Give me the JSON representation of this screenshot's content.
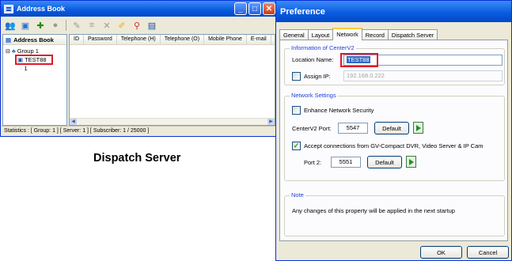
{
  "address_book": {
    "title": "Address Book",
    "toolbar_icons": [
      "users-icon",
      "computer-icon",
      "add-user-icon",
      "user-icon",
      "edit-icon",
      "list-icon",
      "delete-icon",
      "folder-icon",
      "connect-icon",
      "monitor-icon"
    ],
    "tree": {
      "header": "Address Book",
      "group": "Group 1",
      "selected_item": "TEST88",
      "sub_item": "1"
    },
    "columns": [
      "ID",
      "Password",
      "Telephone (H)",
      "Telephone (O)",
      "Mobile Phone",
      "E-mail"
    ],
    "status": "Statistics : [ Group: 1 ]  [ Server: 1 ]  [ Subscriber: 1 / 25000 ]"
  },
  "caption": "Dispatch Server",
  "preference": {
    "title": "Preference",
    "tabs": [
      "General",
      "Layout",
      "Network",
      "Record",
      "Dispatch Server"
    ],
    "active_tab": "Network",
    "info_group": {
      "legend": "Information of CenterV2",
      "location_label": "Location Name:",
      "location_value": "TEST88",
      "assign_ip_label": "Assign IP:",
      "assign_ip_checked": false,
      "assign_ip_value": "192.168.0.222"
    },
    "network_group": {
      "legend": "Network Settings",
      "enhance_label": "Enhance Network Security",
      "enhance_checked": false,
      "port_label": "CenterV2 Port:",
      "port_value": "5547",
      "default_label": "Default",
      "accept_label": "Accept connections from GV-Compact DVR, Video Server & IP Cam",
      "accept_checked": true,
      "port2_label": "Port 2:",
      "port2_value": "5551",
      "default2_label": "Default"
    },
    "note_group": {
      "legend": "Note",
      "text": "Any changes of this property will be applied in the next startup"
    },
    "ok_label": "OK",
    "cancel_label": "Cancel"
  },
  "colors": {
    "title_blue": "#0a5de0",
    "highlight_red": "#e0192a",
    "group_legend_blue": "#1f3fd6",
    "xp_face": "#ece9d8"
  }
}
